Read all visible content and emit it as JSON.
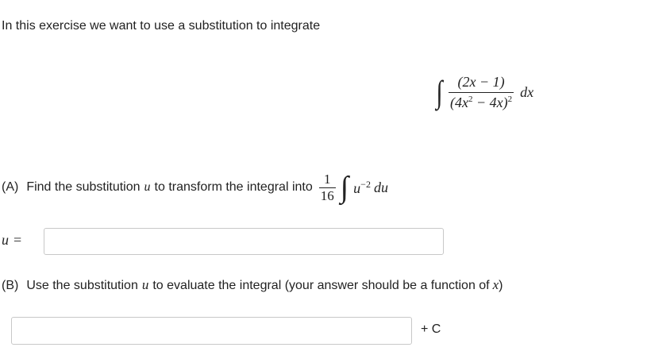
{
  "intro_text": "In this exercise we want to use a substitution to integrate",
  "integral": {
    "sign": "∫",
    "numerator": "(2x − 1)",
    "denominator_base": "(4x",
    "denominator_exp1": "2",
    "denominator_mid": " − 4x)",
    "denominator_exp2": "2",
    "differential": "dx"
  },
  "part_a": {
    "label": "(A)",
    "text": "Find the substitution",
    "var": "u",
    "text2": "to transform the integral into",
    "coef_num": "1",
    "coef_den": "16",
    "sign": "∫",
    "integrand_base": "u",
    "integrand_exp": "−2",
    "differential": "du"
  },
  "u_input": {
    "label_var": "u",
    "label_eq": "=",
    "value": ""
  },
  "part_b": {
    "label": "(B)",
    "text": "Use the substitution",
    "var": "u",
    "text2": "to evaluate the integral (your answer should be a function of",
    "var2": "x",
    "text3": ")"
  },
  "answer_input": {
    "value": "",
    "suffix": "+ C"
  }
}
